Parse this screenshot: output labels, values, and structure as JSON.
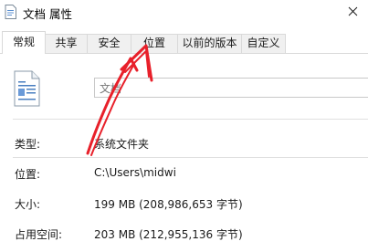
{
  "window": {
    "title": "文档 属性"
  },
  "tabs": [
    {
      "label": "常规",
      "active": true
    },
    {
      "label": "共享",
      "active": false
    },
    {
      "label": "安全",
      "active": false
    },
    {
      "label": "位置",
      "active": false
    },
    {
      "label": "以前的版本",
      "active": false
    },
    {
      "label": "自定义",
      "active": false
    }
  ],
  "general": {
    "name_value": "文档",
    "type_label": "类型:",
    "type_value": "系统文件夹",
    "location_label": "位置:",
    "location_value": "C:\\Users\\midwi",
    "size_label": "大小:",
    "size_value": "199 MB (208,986,653 字节)",
    "disk_label": "占用空间:",
    "disk_value": "203 MB (212,955,136 字节)"
  },
  "annotation": {
    "arrow_color": "#e8202a",
    "icon": "red-arrow-icon"
  },
  "icons": {
    "title": "folder-document-icon",
    "close": "close-icon",
    "file": "document-folder-icon"
  }
}
